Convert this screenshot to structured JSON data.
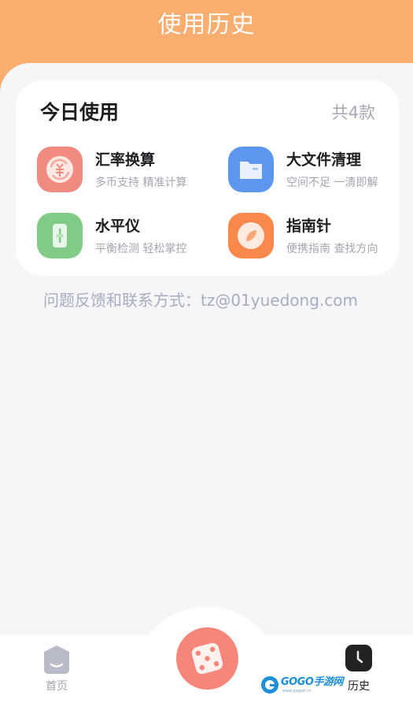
{
  "header": {
    "title": "使用历史"
  },
  "card": {
    "title": "今日使用",
    "count": "共4款",
    "tools": [
      {
        "name": "汇率换算",
        "desc": "多币支持 精准计算",
        "icon": "exchange-rate-icon",
        "color": "#f18b80"
      },
      {
        "name": "大文件清理",
        "desc": "空间不足 一清即解",
        "icon": "folder-icon",
        "color": "#5d96ef"
      },
      {
        "name": "水平仪",
        "desc": "平衡检测 轻松掌控",
        "icon": "level-icon",
        "color": "#82cb87"
      },
      {
        "name": "指南针",
        "desc": "便携指南 查找方向",
        "icon": "compass-icon",
        "color": "#f9884d"
      }
    ]
  },
  "feedback": "问题反馈和联系方式：tz@01yuedong.com",
  "tabbar": {
    "home_label": "首页",
    "history_label": "历史",
    "center_icon": "dice-icon",
    "active_color": "#222222",
    "inactive_color": "#a1a4ad"
  },
  "watermark": {
    "brand": "GOGO手游网",
    "url": "www.gogo8.cn"
  }
}
